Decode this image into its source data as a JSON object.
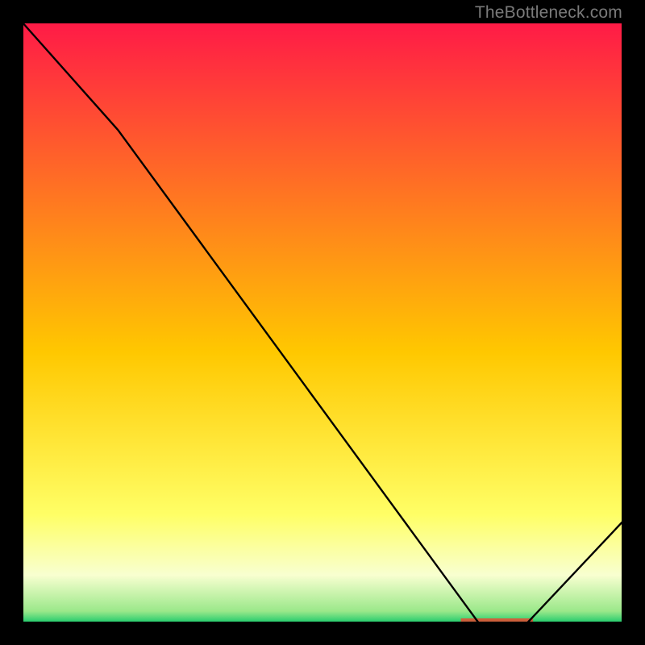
{
  "watermark": "TheBottleneck.com",
  "chart_data": {
    "type": "line",
    "title": "",
    "xlabel": "",
    "ylabel": "",
    "xlim": [
      0,
      100
    ],
    "ylim": [
      0,
      100
    ],
    "x": [
      0,
      16,
      76,
      84,
      100
    ],
    "values": [
      100,
      82,
      0,
      0,
      17
    ],
    "highlight_band": {
      "x_start": 73,
      "x_end": 85
    },
    "gradient_stops": [
      {
        "t": 0.0,
        "color": "#ff1a47"
      },
      {
        "t": 0.55,
        "color": "#ffc800"
      },
      {
        "t": 0.82,
        "color": "#ffff66"
      },
      {
        "t": 0.92,
        "color": "#f8ffd0"
      },
      {
        "t": 0.98,
        "color": "#9be88a"
      },
      {
        "t": 1.0,
        "color": "#18c96b"
      }
    ]
  }
}
